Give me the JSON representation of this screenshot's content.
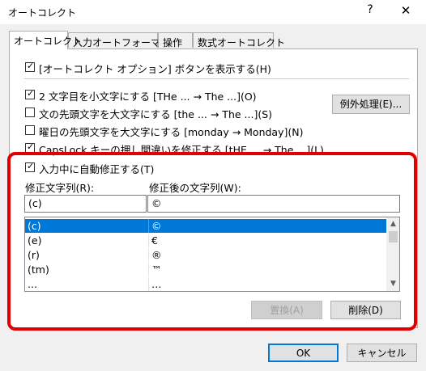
{
  "window": {
    "title": "オートコレクト",
    "help": "?",
    "close": "✕"
  },
  "tabs": [
    "オートコレクト",
    "入力オートフォーマット",
    "操作",
    "数式オートコレクト"
  ],
  "options": {
    "show_buttons": "[オートコレクト オプション] ボタンを表示する(H)",
    "two_caps": "2 文字目を小文字にする [THe ... → The ...](O)",
    "first_letter_sentence": "文の先頭文字を大文字にする [the ... → The ...](S)",
    "day_names": "曜日の先頭文字を大文字にする [monday → Monday](N)",
    "caps_lock": "CapsLock キーの押し間違いを修正する [tHE ... → The ...](L)",
    "replace_as_you_type": "入力中に自動修正する(T)"
  },
  "exceptions_button": "例外処理(E)...",
  "replace": {
    "label": "修正文字列(R):",
    "value": "(c)"
  },
  "with": {
    "label": "修正後の文字列(W):",
    "value": "©"
  },
  "list_rows": [
    {
      "from": "(c)",
      "to": "©",
      "selected": true
    },
    {
      "from": "(e)",
      "to": "€",
      "selected": false
    },
    {
      "from": "(r)",
      "to": "®",
      "selected": false
    },
    {
      "from": "(tm)",
      "to": "™",
      "selected": false
    },
    {
      "from": "...",
      "to": "…",
      "selected": false
    }
  ],
  "buttons": {
    "replace": "置換(A)",
    "delete": "削除(D)",
    "ok": "OK",
    "cancel": "キャンセル"
  },
  "colors": {
    "selection": "#0078d7",
    "highlight_box": "#e00000"
  }
}
